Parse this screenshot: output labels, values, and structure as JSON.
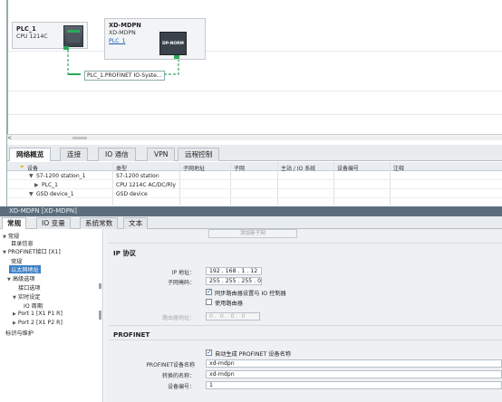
{
  "canvas": {
    "devices": [
      {
        "name": "PLC_1",
        "type": "CPU 1214C",
        "link": ""
      },
      {
        "name": "XD-MDPN",
        "type": "XD-MDPN",
        "link": "PLC_1",
        "module_label": "DP-NORM"
      }
    ],
    "network_label": "PLC_1.PROFINET IO-Syste..."
  },
  "scroll_marker": "<",
  "overview": {
    "tabs": [
      "网络概览",
      "连接",
      "IO 通信",
      "VPN",
      "远程控制"
    ],
    "columns": [
      "设备",
      "类型",
      "子网地址",
      "子网",
      "主站 / IO 系统",
      "设备编号",
      "注释"
    ],
    "rows": [
      {
        "device": "S7-1200 station_1",
        "type": "S7-1200 station"
      },
      {
        "device": "PLC_1",
        "type": "CPU 1214C AC/DC/Rly"
      },
      {
        "device": "GSD device_1",
        "type": "GSD device"
      }
    ]
  },
  "properties": {
    "title": "XD-MDPN [XD-MDPN]",
    "tabs": [
      "常规",
      "IO 变量",
      "系统常数",
      "文本"
    ],
    "nav": [
      "常规",
      "目录信息",
      "PROFINET接口 [X1]",
      "常规",
      "以太网地址",
      "高级选项",
      "接口选项",
      "实时设定",
      "IO 周期",
      "Port 1 [X1 P1 R]",
      "Port 2 [X1 P2 R]",
      "标识与维护"
    ],
    "add_subnet_button": "添加新子网",
    "ip_section": {
      "heading": "IP 协议",
      "ip_label": "IP 地址：",
      "ip_value": [
        "192",
        "168",
        "1",
        "12"
      ],
      "mask_label": "子网掩码：",
      "mask_value": [
        "255",
        "255",
        "255",
        "0"
      ],
      "sync_router_label": "同步路由器设置与 IO 控制器",
      "use_router_label": "使用路由器",
      "router_addr_label": "路由器地址：",
      "router_addr_value": [
        "0",
        "0",
        "0",
        "0"
      ]
    },
    "profinet_section": {
      "heading": "PROFINET",
      "auto_name_label": "自动生成 PROFINET 设备名称",
      "device_name_label": "PROFINET设备名称",
      "device_name_value": "xd-mdpn",
      "converted_name_label": "转换的名称：",
      "converted_name_value": "xd-mdpn",
      "device_number_label": "设备编号：",
      "device_number_value": "1"
    }
  },
  "colors": {
    "title_bar": "#5c6e7e",
    "selection": "#3b7fc4",
    "network_line": "#2ea85a"
  }
}
